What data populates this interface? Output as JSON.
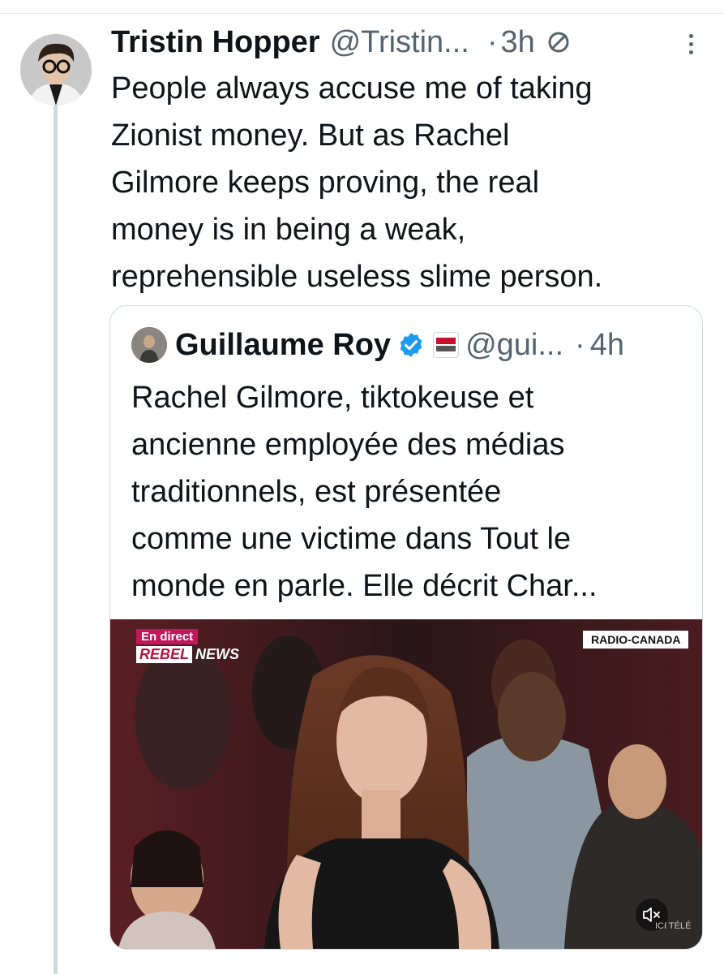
{
  "tweet": {
    "author_name": "Tristin Hopper",
    "author_handle": "@Tristin...",
    "separator": "·",
    "time": "3h",
    "text_lines": [
      "People always accuse me of taking",
      "Zionist money. But as Rachel",
      "Gilmore keeps proving, the real",
      "money is in being a weak,",
      "reprehensible useless slime person."
    ]
  },
  "quote": {
    "author_name": "Guillaume Roy",
    "author_handle": "@gui...",
    "separator": "·",
    "time": "4h",
    "verified_color": "#1d9bf0",
    "text_lines": [
      "Rachel Gilmore, tiktokeuse et",
      "ancienne employée des médias",
      "traditionnels, est présentée",
      "comme une victime dans Tout le",
      "monde en parle. Elle décrit Char..."
    ],
    "media": {
      "live_label": "En direct",
      "brand_part1": "REBEL",
      "brand_part2": "NEWS",
      "broadcaster_label": "RADIO-CANADA",
      "channel_mark": "ICI TÉLÉ"
    }
  },
  "colors": {
    "text_primary": "#0f1419",
    "text_secondary": "#536471",
    "border": "#cfd9de",
    "thread_line": "#cfd9de"
  }
}
